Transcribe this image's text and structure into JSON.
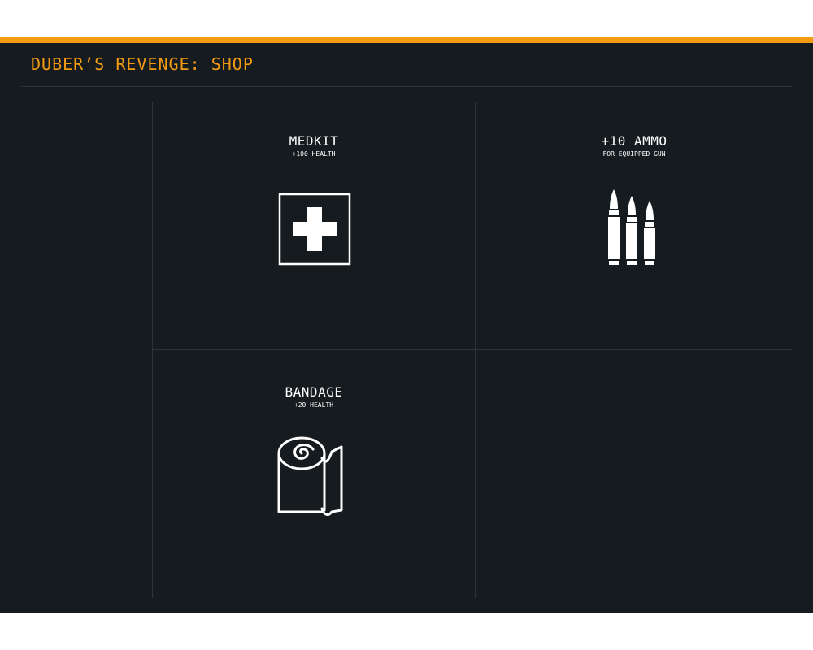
{
  "header": {
    "title": "DUBER’S REVENGE: SHOP"
  },
  "colors": {
    "accent": "#f39c12",
    "background": "#161b1f",
    "divider": "#2c3438",
    "text": "#ffffff"
  },
  "shop": {
    "items": [
      {
        "name": "MEDKIT",
        "description": "+100 HEALTH",
        "icon": "medkit-icon"
      },
      {
        "name": "+10 AMMO",
        "description": "FOR EQUIPPED GUN",
        "icon": "ammo-icon"
      },
      {
        "name": "BANDAGE",
        "description": "+20 HEALTH",
        "icon": "bandage-icon"
      }
    ]
  }
}
